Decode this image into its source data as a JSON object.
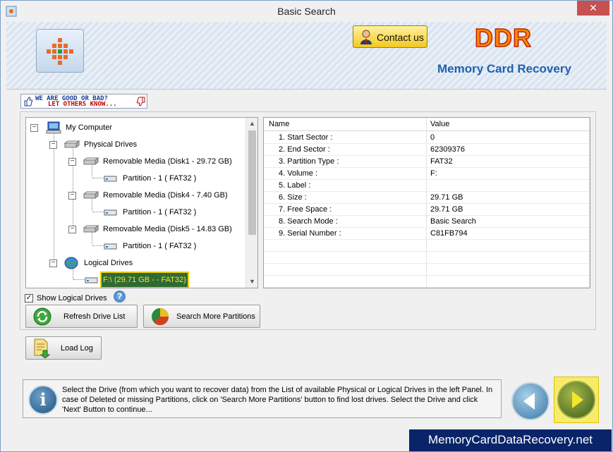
{
  "window": {
    "title": "Basic Search",
    "close_glyph": "✕"
  },
  "header": {
    "contact_label": "Contact us",
    "brand_logo": "DDR",
    "brand_subtitle": "Memory Card Recovery"
  },
  "feedback": {
    "line1": "WE ARE GOOD OR BAD?",
    "line2": "LET OTHERS KNOW..."
  },
  "tree": {
    "root": "My Computer",
    "physical": "Physical Drives",
    "disks": [
      {
        "label": "Removable Media (Disk1 - 29.72 GB)",
        "partition": "Partition - 1 ( FAT32 )"
      },
      {
        "label": "Removable Media (Disk4 - 7.40 GB)",
        "partition": "Partition - 1 ( FAT32 )"
      },
      {
        "label": "Removable Media (Disk5 - 14.83 GB)",
        "partition": "Partition - 1 ( FAT32 )"
      }
    ],
    "logical": "Logical Drives",
    "selected": "F:\\ (29.71 GB -  - FAT32)"
  },
  "grid": {
    "columns": [
      "Name",
      "Value"
    ],
    "rows": [
      {
        "name": "1. Start Sector :",
        "value": "0"
      },
      {
        "name": "2. End Sector :",
        "value": "62309376"
      },
      {
        "name": "3. Partition Type :",
        "value": "FAT32"
      },
      {
        "name": "4. Volume :",
        "value": "F:"
      },
      {
        "name": "5. Label :",
        "value": ""
      },
      {
        "name": "6. Size :",
        "value": "29.71 GB"
      },
      {
        "name": "7. Free Space :",
        "value": "29.71 GB"
      },
      {
        "name": "8. Search Mode :",
        "value": "Basic Search"
      },
      {
        "name": "9. Serial Number :",
        "value": "C81FB794"
      }
    ]
  },
  "options": {
    "show_logical_label": "Show Logical Drives",
    "show_logical_checked": true,
    "help_glyph": "?"
  },
  "buttons": {
    "refresh": "Refresh Drive List",
    "search_more": "Search More Partitions",
    "load_log": "Load Log"
  },
  "info": {
    "text": "Select the Drive (from which you want to recover data) from the List of available Physical or Logical Drives in the left Panel. In case of Deleted or missing Partitions, click on 'Search More Partitions' button to find lost drives. Select the Drive and click 'Next' Button to continue...",
    "glyph": "i"
  },
  "footer": {
    "url": "MemoryCardDataRecovery.net"
  },
  "colors": {
    "selected_bg": "#2e6a36",
    "selected_fg": "#f5e62a",
    "brand_orange": "#ff8800",
    "brand_blue": "#2060b0"
  }
}
